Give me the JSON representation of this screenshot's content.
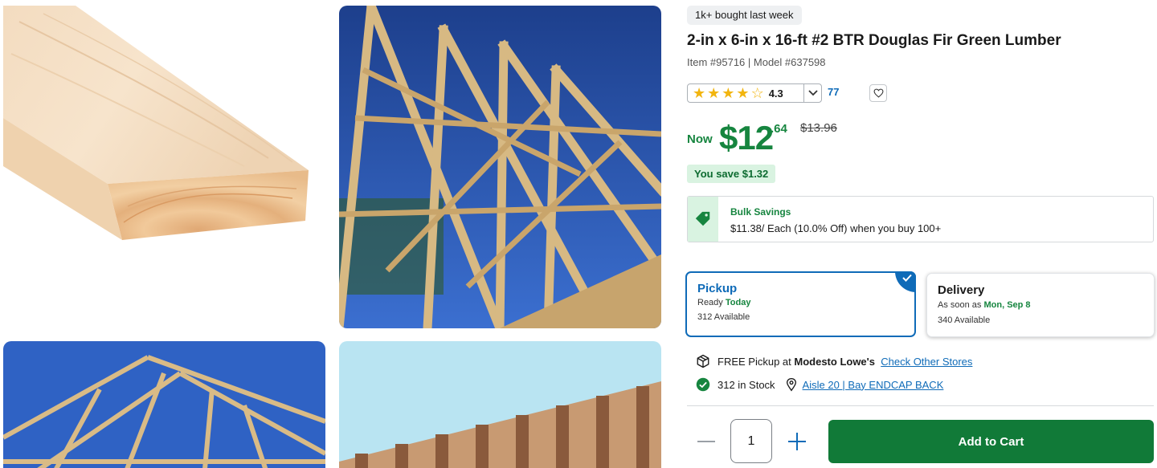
{
  "badge": "1k+ bought last week",
  "product": {
    "title": "2-in x 6-in x 16-ft #2 BTR Douglas Fir Green Lumber",
    "item_label": "Item #95716",
    "model_label": "Model #637598"
  },
  "rating": {
    "value": "4.3",
    "stars": 4.3,
    "review_count": "77"
  },
  "price": {
    "now_label": "Now",
    "dollars": "$12",
    "cents": ".64",
    "was": "$13.96",
    "you_save": "You save $1.32"
  },
  "bulk": {
    "title": "Bulk Savings",
    "description": "$11.38/ Each (10.0% Off) when you buy 100+"
  },
  "fulfillment": {
    "pickup": {
      "title": "Pickup",
      "line1_prefix": "Ready",
      "line1_value": "Today",
      "line2": "312 Available"
    },
    "delivery": {
      "title": "Delivery",
      "line1_prefix": "As soon as",
      "line1_value": "Mon, Sep 8",
      "line2": "340 Available"
    }
  },
  "store": {
    "free_pickup_prefix": "FREE Pickup at",
    "store_name": "Modesto Lowe's",
    "check_other": "Check Other Stores",
    "stock": "312 in Stock",
    "aisle": "Aisle 20 | Bay ENDCAP BACK"
  },
  "cart": {
    "quantity": "1",
    "add_label": "Add to Cart"
  },
  "colors": {
    "accent_green": "#117a38",
    "price_green": "#16853f",
    "link_blue": "#0f6bb8",
    "star_gold": "#f2b50f"
  },
  "icons": [
    "minus-icon",
    "plus-icon",
    "heart-icon",
    "chevron-down-icon",
    "tag-icon",
    "box-icon",
    "check-circle-icon",
    "location-pin-icon",
    "checkmark-icon",
    "star-icon"
  ]
}
